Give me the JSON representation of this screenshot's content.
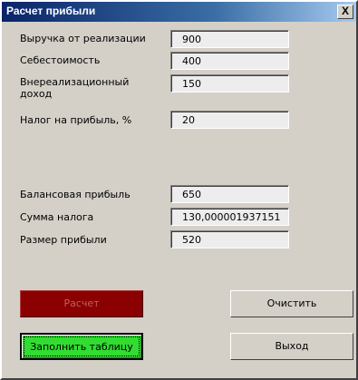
{
  "window": {
    "title": "Расчет прибыли",
    "close_label": "X"
  },
  "inputs": {
    "revenue": {
      "label": "Выручка от реализации",
      "value": "900"
    },
    "cost": {
      "label": "Себестоимость",
      "value": "400"
    },
    "other_income": {
      "label": "Внереализационный доход",
      "value": "150"
    },
    "tax_rate": {
      "label": "Налог на прибыль, %",
      "value": "20"
    }
  },
  "outputs": {
    "balance_profit": {
      "label": "Балансовая прибыль",
      "value": "650"
    },
    "tax_amount": {
      "label": "Сумма налога",
      "value": "130,000001937151"
    },
    "net_profit": {
      "label": "Размер прибыли",
      "value": "520"
    }
  },
  "buttons": {
    "calculate": "Расчет",
    "fill_table": "Заполнить таблицу",
    "clear": "Очистить",
    "exit": "Выход"
  },
  "colors": {
    "calculate_bg": "#8b0000",
    "fill_table_bg": "#32dc32",
    "titlebar": "#0a246a"
  }
}
